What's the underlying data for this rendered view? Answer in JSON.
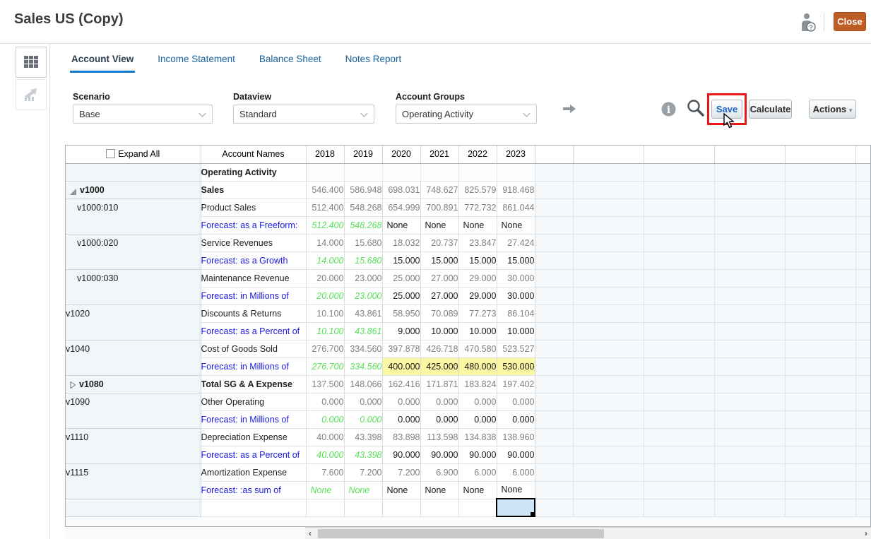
{
  "header": {
    "title": "Sales US (Copy)",
    "close_label": "Close"
  },
  "tabs": [
    {
      "label": "Account View",
      "active": true
    },
    {
      "label": "Income Statement",
      "active": false
    },
    {
      "label": "Balance Sheet",
      "active": false
    },
    {
      "label": "Notes Report",
      "active": false
    }
  ],
  "toolbar": {
    "filters": {
      "scenario": {
        "label": "Scenario",
        "value": "Base"
      },
      "dataview": {
        "label": "Dataview",
        "value": "Standard"
      },
      "account_groups": {
        "label": "Account Groups",
        "value": "Operating Activity"
      }
    },
    "buttons": {
      "save": "Save",
      "calculate": "Calculate",
      "actions": "Actions"
    }
  },
  "icons": {
    "user_help": "person-with-question-badge",
    "forward": "right-arrow",
    "info": "i",
    "search": "magnifier",
    "scroll_left": "‹",
    "scroll_right": "›",
    "actions_caret": "▾"
  },
  "colors": {
    "close_button": "#bf5d26",
    "tab_accent": "#0b79d0",
    "forecast_link": "#1a1adf",
    "history_green": "#58e158",
    "edited_yellow": "#fbf7a3",
    "selected_cell": "#cde6f7",
    "annotation_red": "#ea1515"
  },
  "grid": {
    "expand_all_label": "Expand All",
    "account_names_header": "Account Names",
    "years": [
      {
        "label": "2018",
        "link": false
      },
      {
        "label": "2019",
        "link": false
      },
      {
        "label": "2020",
        "link": true
      },
      {
        "label": "2021",
        "link": true
      },
      {
        "label": "2022",
        "link": true
      },
      {
        "label": "2023",
        "link": true
      }
    ],
    "selection": {
      "year": "2023",
      "row": "blank-entry-row"
    },
    "rows": [
      {
        "kind": "group",
        "name": "Operating Activity"
      },
      {
        "kind": "account",
        "code": "v1000",
        "codeBold": true,
        "tri": "open",
        "name": "Sales",
        "nameBold": true,
        "span": 1,
        "vals": [
          "546.400",
          "586.948",
          "698.031",
          "748.627",
          "825.579",
          "918.468"
        ]
      },
      {
        "kind": "account",
        "code": "v1000:010",
        "indent": true,
        "name": "Product Sales",
        "span": 2,
        "vals": [
          "512.400",
          "548.268",
          "654.999",
          "700.891",
          "772.732",
          "861.044"
        ]
      },
      {
        "kind": "forecast",
        "name": "Forecast: as a Freeform:",
        "vals": [
          "512.400",
          "548.268",
          "None",
          "None",
          "None",
          "None"
        ]
      },
      {
        "kind": "account",
        "code": "v1000:020",
        "indent": true,
        "name": "Service Revenues",
        "span": 2,
        "vals": [
          "14.000",
          "15.680",
          "18.032",
          "20.737",
          "23.847",
          "27.424"
        ]
      },
      {
        "kind": "forecast",
        "name": "Forecast: as a Growth",
        "vals": [
          "14.000",
          "15.680",
          "15.000",
          "15.000",
          "15.000",
          "15.000"
        ]
      },
      {
        "kind": "account",
        "code": "v1000:030",
        "indent": true,
        "name": "Maintenance Revenue",
        "span": 2,
        "vals": [
          "20.000",
          "23.000",
          "25.000",
          "27.000",
          "29.000",
          "30.000"
        ]
      },
      {
        "kind": "forecast",
        "name": "Forecast: in Millions of",
        "vals": [
          "20.000",
          "23.000",
          "25.000",
          "27.000",
          "29.000",
          "30.000"
        ]
      },
      {
        "kind": "account",
        "code": "v1020",
        "name": "Discounts & Returns",
        "span": 2,
        "vals": [
          "10.100",
          "43.861",
          "58.950",
          "70.089",
          "77.273",
          "86.104"
        ]
      },
      {
        "kind": "forecast",
        "name": "Forecast: as a Percent of",
        "vals": [
          "10.100",
          "43.861",
          "9.000",
          "10.000",
          "10.000",
          "10.000"
        ]
      },
      {
        "kind": "account",
        "code": "v1040",
        "name": "Cost of Goods Sold",
        "span": 2,
        "vals": [
          "276.700",
          "334.560",
          "397.878",
          "426.718",
          "470.580",
          "523.527"
        ]
      },
      {
        "kind": "forecast",
        "name": "Forecast: in Millions of",
        "yellow": true,
        "vals": [
          "276.700",
          "334.560",
          "400.000",
          "425.000",
          "480.000",
          "530.000"
        ]
      },
      {
        "kind": "account",
        "code": "v1080",
        "codeBold": true,
        "tri": "closed",
        "name": "Total SG & A Expense",
        "nameBold": true,
        "span": 1,
        "vals": [
          "137.500",
          "148.066",
          "162.416",
          "171.871",
          "183.824",
          "197.402"
        ]
      },
      {
        "kind": "account",
        "code": "v1090",
        "name": "Other Operating",
        "span": 2,
        "vals": [
          "0.000",
          "0.000",
          "0.000",
          "0.000",
          "0.000",
          "0.000"
        ]
      },
      {
        "kind": "forecast",
        "name": "Forecast: in Millions of",
        "vals": [
          "0.000",
          "0.000",
          "0.000",
          "0.000",
          "0.000",
          "0.000"
        ]
      },
      {
        "kind": "account",
        "code": "v1110",
        "name": "Depreciation Expense",
        "span": 2,
        "vals": [
          "40.000",
          "43.398",
          "83.898",
          "113.598",
          "134.838",
          "138.960"
        ]
      },
      {
        "kind": "forecast",
        "name": "Forecast: as a Percent of",
        "vals": [
          "40.000",
          "43.398",
          "90.000",
          "90.000",
          "90.000",
          "90.000"
        ]
      },
      {
        "kind": "account",
        "code": "v1115",
        "name": "Amortization Expense",
        "span": 2,
        "vals": [
          "7.600",
          "7.200",
          "7.200",
          "6.900",
          "6.000",
          "6.000"
        ]
      },
      {
        "kind": "forecast",
        "name": "Forecast: :as sum of",
        "vals": [
          "None",
          "None",
          "None",
          "None",
          "None",
          "None"
        ]
      },
      {
        "kind": "empty-selected"
      }
    ]
  }
}
